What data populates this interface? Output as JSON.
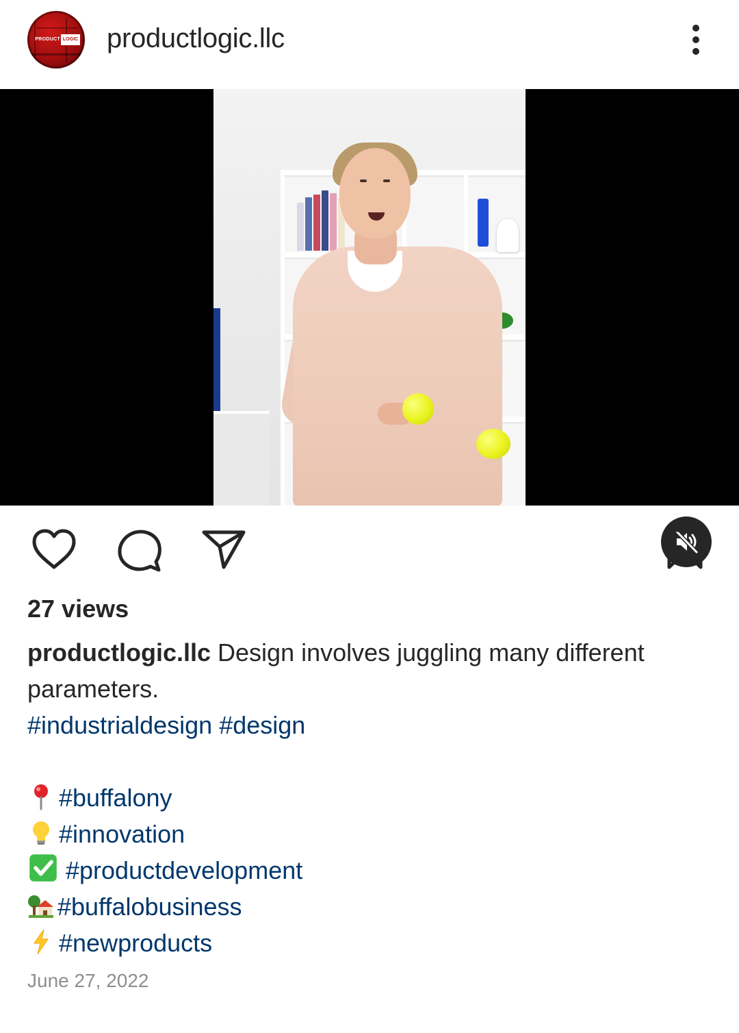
{
  "post": {
    "username": "productlogic.llc",
    "avatar_logo_left": "PRODUCT",
    "avatar_logo_right": "LOGIC",
    "views": "27 views",
    "caption_user": "productlogic.llc",
    "caption_text_line1": "Design involves juggling many different",
    "caption_text_line2": "parameters.",
    "hashtags_line": [
      "#industrialdesign",
      "#design"
    ],
    "tag_lines": [
      {
        "emoji": "round-pushpin-icon",
        "tag": "#buffalony"
      },
      {
        "emoji": "light-bulb-icon",
        "tag": "#innovation"
      },
      {
        "emoji": "check-mark-button-icon",
        "tag": "#productdevelopment"
      },
      {
        "emoji": "house-with-garden-icon",
        "tag": "#buffalobusiness"
      },
      {
        "emoji": "high-voltage-icon",
        "tag": "#newproducts"
      }
    ],
    "date": "June 27, 2022"
  },
  "colors": {
    "text": "#262626",
    "hashtag": "#00376b",
    "muted": "#8e8e8e",
    "video_bg": "#000000",
    "brand_red": "#b01010"
  },
  "icons": {
    "more": "more-vertical-icon",
    "mute": "speaker-muted-icon",
    "like": "heart-icon",
    "comment": "comment-bubble-icon",
    "share": "paper-plane-icon",
    "save": "bookmark-icon"
  }
}
